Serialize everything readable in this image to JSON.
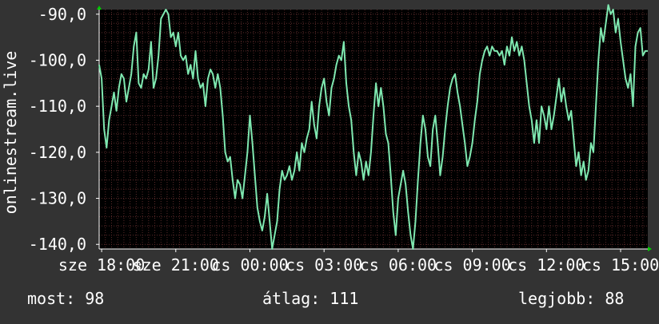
{
  "chart_data": {
    "type": "line",
    "ylabel": "onlinestream.live",
    "ylim": [
      -141,
      -89
    ],
    "yticks": [
      -140,
      -130,
      -120,
      -110,
      -100,
      -90
    ],
    "ytick_labels": [
      "-140,0",
      "-130,0",
      "-120,0",
      "-110,0",
      "-100,0",
      "-90,0"
    ],
    "xlim": [
      17.9,
      40.1
    ],
    "xticks": [
      {
        "pos": 18,
        "label": "sze 18:00"
      },
      {
        "pos": 21,
        "label": "sze 21:00"
      },
      {
        "pos": 24,
        "label": "cs 00:00"
      },
      {
        "pos": 27,
        "label": "cs 03:00"
      },
      {
        "pos": 30,
        "label": "cs 06:00"
      },
      {
        "pos": 33,
        "label": "cs 09:00"
      },
      {
        "pos": 36,
        "label": "cs 12:00"
      },
      {
        "pos": 39,
        "label": "cs 15:00"
      }
    ],
    "grid": true,
    "colors": {
      "background": "#333333",
      "plot": "#000000",
      "line": "#7fe8b0",
      "grid": "#5a2a2a",
      "axis_arrow": "#00cc00"
    },
    "series": [
      {
        "color": "#7fe8b0",
        "points": [
          [
            17.9,
            -101
          ],
          [
            18.0,
            -104
          ],
          [
            18.1,
            -115
          ],
          [
            18.2,
            -119
          ],
          [
            18.3,
            -113
          ],
          [
            18.4,
            -110
          ],
          [
            18.5,
            -107
          ],
          [
            18.6,
            -111
          ],
          [
            18.7,
            -106
          ],
          [
            18.8,
            -103
          ],
          [
            18.9,
            -104
          ],
          [
            19.0,
            -109
          ],
          [
            19.1,
            -106
          ],
          [
            19.2,
            -103
          ],
          [
            19.3,
            -97
          ],
          [
            19.4,
            -94
          ],
          [
            19.5,
            -105
          ],
          [
            19.6,
            -106
          ],
          [
            19.7,
            -103
          ],
          [
            19.8,
            -104
          ],
          [
            19.9,
            -102
          ],
          [
            20.0,
            -96
          ],
          [
            20.1,
            -106
          ],
          [
            20.2,
            -104
          ],
          [
            20.3,
            -99
          ],
          [
            20.4,
            -91
          ],
          [
            20.5,
            -90
          ],
          [
            20.6,
            -89
          ],
          [
            20.7,
            -90
          ],
          [
            20.8,
            -95
          ],
          [
            20.9,
            -94
          ],
          [
            21.0,
            -97
          ],
          [
            21.1,
            -94
          ],
          [
            21.2,
            -99
          ],
          [
            21.3,
            -100
          ],
          [
            21.4,
            -99
          ],
          [
            21.5,
            -103
          ],
          [
            21.6,
            -101
          ],
          [
            21.7,
            -104
          ],
          [
            21.8,
            -98
          ],
          [
            21.9,
            -104
          ],
          [
            22.0,
            -106
          ],
          [
            22.1,
            -105
          ],
          [
            22.2,
            -110
          ],
          [
            22.3,
            -104
          ],
          [
            22.4,
            -102
          ],
          [
            22.5,
            -103
          ],
          [
            22.6,
            -106
          ],
          [
            22.7,
            -103
          ],
          [
            22.8,
            -106
          ],
          [
            22.9,
            -112
          ],
          [
            23.0,
            -120
          ],
          [
            23.1,
            -122
          ],
          [
            23.2,
            -121
          ],
          [
            23.3,
            -126
          ],
          [
            23.4,
            -130
          ],
          [
            23.5,
            -126
          ],
          [
            23.6,
            -127
          ],
          [
            23.7,
            -130
          ],
          [
            23.8,
            -125
          ],
          [
            23.9,
            -120
          ],
          [
            24.0,
            -112
          ],
          [
            24.1,
            -118
          ],
          [
            24.2,
            -125
          ],
          [
            24.3,
            -132
          ],
          [
            24.4,
            -135
          ],
          [
            24.5,
            -137
          ],
          [
            24.6,
            -134
          ],
          [
            24.7,
            -129
          ],
          [
            24.8,
            -135
          ],
          [
            24.9,
            -141
          ],
          [
            25.0,
            -138
          ],
          [
            25.1,
            -135
          ],
          [
            25.2,
            -128
          ],
          [
            25.3,
            -124
          ],
          [
            25.4,
            -126
          ],
          [
            25.5,
            -125
          ],
          [
            25.6,
            -123
          ],
          [
            25.7,
            -126
          ],
          [
            25.8,
            -124
          ],
          [
            25.9,
            -120
          ],
          [
            26.0,
            -124
          ],
          [
            26.1,
            -118
          ],
          [
            26.2,
            -120
          ],
          [
            26.3,
            -117
          ],
          [
            26.4,
            -115
          ],
          [
            26.5,
            -109
          ],
          [
            26.6,
            -114
          ],
          [
            26.7,
            -117
          ],
          [
            26.8,
            -110
          ],
          [
            26.9,
            -106
          ],
          [
            27.0,
            -104
          ],
          [
            27.1,
            -109
          ],
          [
            27.2,
            -112
          ],
          [
            27.3,
            -106
          ],
          [
            27.4,
            -104
          ],
          [
            27.5,
            -101
          ],
          [
            27.6,
            -99
          ],
          [
            27.7,
            -100
          ],
          [
            27.8,
            -96
          ],
          [
            27.9,
            -105
          ],
          [
            28.0,
            -110
          ],
          [
            28.1,
            -113
          ],
          [
            28.2,
            -120
          ],
          [
            28.3,
            -125
          ],
          [
            28.4,
            -120
          ],
          [
            28.5,
            -122
          ],
          [
            28.6,
            -126
          ],
          [
            28.7,
            -122
          ],
          [
            28.8,
            -125
          ],
          [
            28.9,
            -120
          ],
          [
            29.0,
            -112
          ],
          [
            29.1,
            -105
          ],
          [
            29.2,
            -110
          ],
          [
            29.3,
            -106
          ],
          [
            29.4,
            -110
          ],
          [
            29.5,
            -116
          ],
          [
            29.6,
            -118
          ],
          [
            29.7,
            -125
          ],
          [
            29.8,
            -133
          ],
          [
            29.9,
            -138
          ],
          [
            30.0,
            -130
          ],
          [
            30.1,
            -127
          ],
          [
            30.2,
            -124
          ],
          [
            30.3,
            -127
          ],
          [
            30.4,
            -133
          ],
          [
            30.5,
            -138
          ],
          [
            30.6,
            -141
          ],
          [
            30.7,
            -135
          ],
          [
            30.8,
            -126
          ],
          [
            30.9,
            -118
          ],
          [
            31.0,
            -112
          ],
          [
            31.1,
            -115
          ],
          [
            31.2,
            -121
          ],
          [
            31.3,
            -123
          ],
          [
            31.4,
            -115
          ],
          [
            31.5,
            -112
          ],
          [
            31.6,
            -118
          ],
          [
            31.7,
            -125
          ],
          [
            31.8,
            -121
          ],
          [
            31.9,
            -115
          ],
          [
            32.0,
            -110
          ],
          [
            32.1,
            -106
          ],
          [
            32.2,
            -104
          ],
          [
            32.3,
            -103
          ],
          [
            32.4,
            -107
          ],
          [
            32.5,
            -110
          ],
          [
            32.6,
            -114
          ],
          [
            32.7,
            -118
          ],
          [
            32.8,
            -123
          ],
          [
            32.9,
            -121
          ],
          [
            33.0,
            -118
          ],
          [
            33.1,
            -113
          ],
          [
            33.2,
            -109
          ],
          [
            33.3,
            -103
          ],
          [
            33.4,
            -100
          ],
          [
            33.5,
            -98
          ],
          [
            33.6,
            -97
          ],
          [
            33.7,
            -99
          ],
          [
            33.8,
            -97
          ],
          [
            33.9,
            -98
          ],
          [
            34.0,
            -98
          ],
          [
            34.1,
            -99
          ],
          [
            34.2,
            -98
          ],
          [
            34.3,
            -101
          ],
          [
            34.4,
            -97
          ],
          [
            34.5,
            -99
          ],
          [
            34.6,
            -95
          ],
          [
            34.7,
            -98
          ],
          [
            34.8,
            -96
          ],
          [
            34.9,
            -99
          ],
          [
            35.0,
            -97
          ],
          [
            35.1,
            -100
          ],
          [
            35.2,
            -105
          ],
          [
            35.3,
            -110
          ],
          [
            35.4,
            -113
          ],
          [
            35.5,
            -118
          ],
          [
            35.6,
            -113
          ],
          [
            35.7,
            -118
          ],
          [
            35.8,
            -110
          ],
          [
            35.9,
            -112
          ],
          [
            36.0,
            -115
          ],
          [
            36.1,
            -110
          ],
          [
            36.2,
            -115
          ],
          [
            36.3,
            -112
          ],
          [
            36.4,
            -108
          ],
          [
            36.5,
            -104
          ],
          [
            36.6,
            -109
          ],
          [
            36.7,
            -106
          ],
          [
            36.8,
            -110
          ],
          [
            36.9,
            -113
          ],
          [
            37.0,
            -111
          ],
          [
            37.1,
            -117
          ],
          [
            37.2,
            -123
          ],
          [
            37.3,
            -120
          ],
          [
            37.4,
            -125
          ],
          [
            37.5,
            -122
          ],
          [
            37.6,
            -126
          ],
          [
            37.7,
            -124
          ],
          [
            37.8,
            -118
          ],
          [
            37.9,
            -120
          ],
          [
            38.0,
            -110
          ],
          [
            38.1,
            -100
          ],
          [
            38.2,
            -93
          ],
          [
            38.3,
            -96
          ],
          [
            38.4,
            -92
          ],
          [
            38.5,
            -88
          ],
          [
            38.6,
            -90
          ],
          [
            38.7,
            -89
          ],
          [
            38.8,
            -94
          ],
          [
            38.9,
            -91
          ],
          [
            39.0,
            -96
          ],
          [
            39.1,
            -100
          ],
          [
            39.2,
            -104
          ],
          [
            39.3,
            -106
          ],
          [
            39.4,
            -103
          ],
          [
            39.5,
            -110
          ],
          [
            39.6,
            -97
          ],
          [
            39.7,
            -94
          ],
          [
            39.8,
            -93
          ],
          [
            39.9,
            -99
          ],
          [
            40.0,
            -98
          ],
          [
            40.1,
            -98
          ]
        ]
      }
    ]
  },
  "footer": {
    "current": "most: 98",
    "average": "átlag: 111",
    "best": "legjobb: 88"
  }
}
